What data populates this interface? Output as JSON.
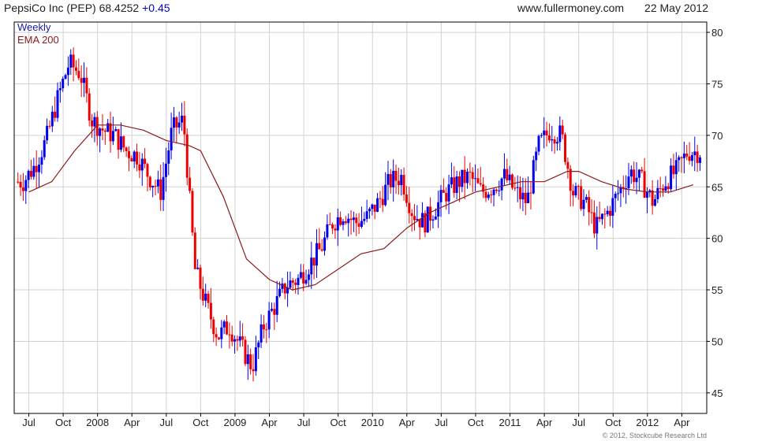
{
  "header": {
    "title": "PepsiCo Inc (PEP) 68.4252",
    "change": "+0.45",
    "source": "www.fullermoney.com",
    "date": "22 May 2012"
  },
  "legend": {
    "weekly": "Weekly",
    "ema": "EMA 200"
  },
  "copyright": "© 2012, Stockcube Research Ltd",
  "colors": {
    "up": "#0000ee",
    "down": "#ee0000",
    "ema": "#8b1a1a",
    "grid": "#d2d2d2",
    "axis": "#000000"
  },
  "chart_data": {
    "type": "line",
    "title": "PepsiCo Inc (PEP) 68.4252 +0.45",
    "ylabel": "",
    "xlabel": "",
    "ylim": [
      43,
      81
    ],
    "y_ticks": [
      45,
      50,
      55,
      60,
      65,
      70,
      75,
      80
    ],
    "x_ticks": [
      "Jul",
      "Oct",
      "2008",
      "Apr",
      "Jul",
      "Oct",
      "2009",
      "Apr",
      "Jul",
      "Oct",
      "2010",
      "Apr",
      "Jul",
      "Oct",
      "2011",
      "Apr",
      "Jul",
      "Oct",
      "2012",
      "Apr"
    ],
    "x_start": "2007-06",
    "x_end": "2012-05",
    "grid": true,
    "series": [
      {
        "name": "Weekly",
        "style": "candlestick",
        "x": [
          "2007-07",
          "2007-08",
          "2007-09",
          "2007-10",
          "2007-11",
          "2007-12",
          "2008-01",
          "2008-02",
          "2008-03",
          "2008-04",
          "2008-05",
          "2008-06",
          "2008-07",
          "2008-08",
          "2008-09",
          "2008-10",
          "2008-11",
          "2008-12",
          "2009-01",
          "2009-02",
          "2009-03",
          "2009-04",
          "2009-05",
          "2009-06",
          "2009-07",
          "2009-08",
          "2009-09",
          "2009-10",
          "2009-11",
          "2009-12",
          "2010-01",
          "2010-02",
          "2010-03",
          "2010-04",
          "2010-05",
          "2010-06",
          "2010-07",
          "2010-08",
          "2010-09",
          "2010-10",
          "2010-11",
          "2010-12",
          "2011-01",
          "2011-02",
          "2011-03",
          "2011-04",
          "2011-05",
          "2011-06",
          "2011-07",
          "2011-08",
          "2011-09",
          "2011-10",
          "2011-11",
          "2011-12",
          "2012-01",
          "2012-02",
          "2012-03",
          "2012-04",
          "2012-05"
        ],
        "values": [
          65.5,
          67.0,
          69.5,
          73.5,
          77.0,
          76.0,
          71.5,
          70.5,
          70.0,
          68.5,
          68.0,
          66.0,
          64.5,
          70.5,
          71.5,
          57.0,
          53.5,
          50.5,
          51.5,
          49.5,
          47.5,
          51.5,
          53.5,
          55.5,
          56.0,
          57.5,
          59.0,
          61.5,
          62.5,
          61.5,
          62.0,
          63.5,
          65.5,
          66.0,
          62.5,
          61.5,
          63.0,
          64.5,
          65.5,
          66.0,
          64.5,
          65.0,
          66.0,
          64.5,
          63.5,
          69.0,
          70.5,
          70.0,
          64.5,
          63.5,
          61.0,
          62.5,
          64.5,
          66.5,
          65.5,
          63.5,
          65.5,
          66.5,
          68.4
        ]
      },
      {
        "name": "EMA 200",
        "x": [
          "2007-07",
          "2007-09",
          "2007-11",
          "2008-01",
          "2008-03",
          "2008-05",
          "2008-07",
          "2008-09",
          "2008-10",
          "2008-12",
          "2009-02",
          "2009-04",
          "2009-06",
          "2009-08",
          "2009-10",
          "2009-12",
          "2010-02",
          "2010-04",
          "2010-06",
          "2010-08",
          "2010-10",
          "2010-12",
          "2011-02",
          "2011-04",
          "2011-06",
          "2011-07",
          "2011-09",
          "2011-11",
          "2012-01",
          "2012-03",
          "2012-05"
        ],
        "values": [
          64.5,
          65.5,
          68.5,
          71.0,
          71.0,
          70.5,
          69.5,
          69.0,
          68.5,
          64.0,
          58.0,
          56.0,
          55.0,
          55.5,
          57.0,
          58.5,
          59.0,
          61.0,
          62.5,
          63.5,
          64.5,
          65.0,
          65.5,
          65.5,
          66.5,
          66.5,
          65.5,
          64.8,
          64.5,
          64.5,
          65.2
        ]
      }
    ]
  }
}
